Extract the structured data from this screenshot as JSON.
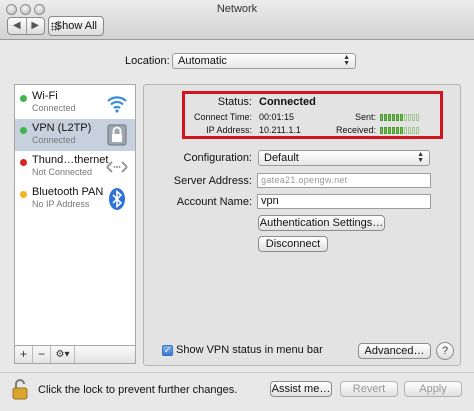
{
  "window": {
    "title": "Network"
  },
  "toolbar": {
    "show_all_label": "Show All",
    "back": "◀",
    "forward": "▶"
  },
  "location": {
    "label": "Location:",
    "value": "Automatic"
  },
  "sidebar": {
    "items": [
      {
        "name": "Wi-Fi",
        "state": "Connected",
        "dot_color": "#3fb54a",
        "icon": "wifi-icon"
      },
      {
        "name": "VPN (L2TP)",
        "state": "Connected",
        "dot_color": "#3fb54a",
        "icon": "vpn-lock-icon"
      },
      {
        "name": "Thund…thernet",
        "state": "Not Connected",
        "dot_color": "#d8261e",
        "icon": "thunderbolt-arrows-icon"
      },
      {
        "name": "Bluetooth PAN",
        "state": "No IP Address",
        "dot_color": "#f2b61c",
        "icon": "bluetooth-icon"
      }
    ],
    "add_label": "+",
    "remove_label": "−",
    "gear_label": "⚙▾"
  },
  "status": {
    "status_label": "Status:",
    "status_value": "Connected",
    "connect_time_label": "Connect Time:",
    "connect_time_value": "00:01:15",
    "ip_label": "IP Address:",
    "ip_value": "10.211.1.1",
    "sent_label": "Sent:",
    "received_label": "Received:",
    "sent_level": 0.6,
    "received_level": 0.6,
    "highlight_color": "#d2141c"
  },
  "form": {
    "configuration_label": "Configuration:",
    "configuration_value": "Default",
    "server_label": "Server Address:",
    "server_value": "gatea21.opengw.net",
    "account_label": "Account Name:",
    "account_value": "vpn",
    "auth_button": "Authentication Settings…",
    "disconnect_button": "Disconnect"
  },
  "options": {
    "show_vpn_status_label": "Show VPN status in menu bar",
    "show_vpn_status_checked": true,
    "advanced_button": "Advanced…",
    "help_label": "?"
  },
  "footer": {
    "lock_text": "Click the lock to prevent further changes.",
    "assist_button": "Assist me…",
    "revert_button": "Revert",
    "apply_button": "Apply"
  }
}
